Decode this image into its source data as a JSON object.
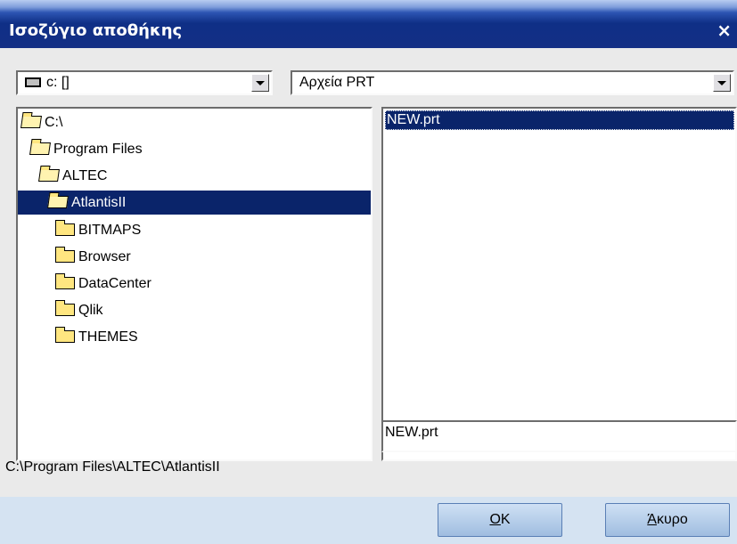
{
  "window": {
    "title": "Ισοζύγιο αποθήκης",
    "close_label": "×"
  },
  "drive_select": {
    "value": "c: []"
  },
  "file_type_select": {
    "value": "Αρχεία PRT"
  },
  "directory_tree": [
    {
      "label": "C:\\",
      "state": "open"
    },
    {
      "label": "Program Files",
      "state": "open"
    },
    {
      "label": "ALTEC",
      "state": "open"
    },
    {
      "label": "AtlantisII",
      "state": "selected"
    },
    {
      "label": "BITMAPS",
      "state": "closed"
    },
    {
      "label": "Browser",
      "state": "closed"
    },
    {
      "label": "DataCenter",
      "state": "closed"
    },
    {
      "label": "Qlik",
      "state": "closed"
    },
    {
      "label": "THEMES",
      "state": "closed"
    }
  ],
  "file_list": [
    {
      "label": "NEW.prt",
      "selected": true
    }
  ],
  "filename_field": {
    "value": "NEW.prt"
  },
  "current_path": "C:\\Program Files\\ALTEC\\AtlantisII",
  "buttons": {
    "ok_mnemonic": "O",
    "ok_rest": "K",
    "cancel_mnemonic": "Ά",
    "cancel_rest": "κυρο"
  },
  "colors": {
    "title_bar": "#0f2f86",
    "selection": "#0a246a",
    "dialog_body": "#eaeaea",
    "footer": "#d5e3f2"
  }
}
